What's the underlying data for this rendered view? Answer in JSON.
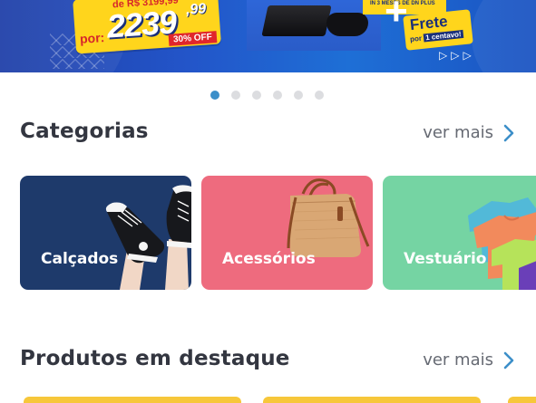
{
  "banner": {
    "old_price": "de R$ 3199,99",
    "price_prefix": "por:",
    "price": "2239",
    "price_cents": ",99",
    "discount": "30% OFF",
    "promo_small": "IN 3 MESES DE DN PLUS",
    "plus": "+",
    "shipping_title": "Frete",
    "shipping_sub_a": "por",
    "shipping_sub_b": "1 centavo!",
    "arrows": "▷▷▷"
  },
  "carousel": {
    "dots": 6,
    "active_index": 0
  },
  "categories": {
    "title": "Categorias",
    "see_more": "ver mais",
    "items": [
      {
        "label": "Calçados",
        "bg": "#1e3a6b",
        "icon": "sneakers-image"
      },
      {
        "label": "Acessórios",
        "bg": "#ee6b7e",
        "icon": "handbag-image"
      },
      {
        "label": "Vestuário",
        "bg": "#75d4a3",
        "icon": "tshirts-image"
      }
    ]
  },
  "featured": {
    "title": "Produtos em destaque",
    "see_more": "ver mais"
  },
  "colors": {
    "accent": "#3c8fc9",
    "title_text": "#333640",
    "see_more_text": "#666a73"
  }
}
